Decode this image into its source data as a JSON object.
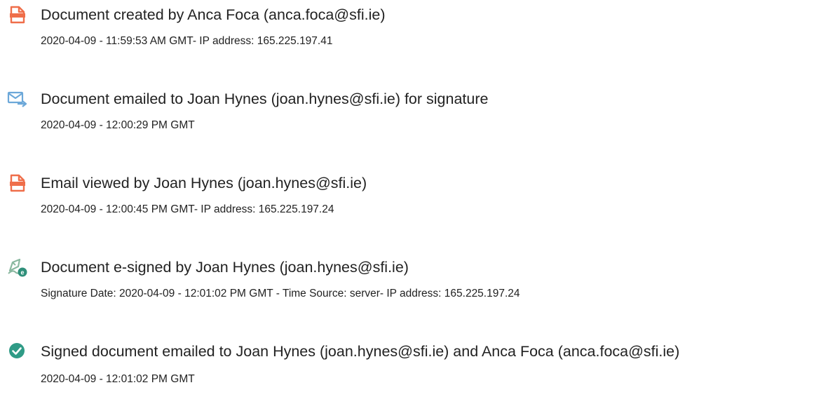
{
  "colors": {
    "document_icon": "#EF6E4A",
    "email_icon": "#6CA8D9",
    "esign_icon": "#8AB8A0",
    "esign_badge": "#2F8F7A",
    "check_icon": "#2F9B86",
    "text": "#222222"
  },
  "events": [
    {
      "icon": "document-icon",
      "title": "Document created by Anca Foca (anca.foca@sfi.ie)",
      "meta": "2020-04-09 - 11:59:53 AM GMT- IP address: 165.225.197.41"
    },
    {
      "icon": "email-send-icon",
      "title": "Document emailed to Joan Hynes (joan.hynes@sfi.ie) for signature",
      "meta": "2020-04-09 - 12:00:29 PM GMT"
    },
    {
      "icon": "document-icon",
      "title": "Email viewed by Joan Hynes (joan.hynes@sfi.ie)",
      "meta": "2020-04-09 - 12:00:45 PM GMT- IP address: 165.225.197.24"
    },
    {
      "icon": "esign-pen-icon",
      "title": "Document e-signed by Joan Hynes (joan.hynes@sfi.ie)",
      "meta": "Signature Date: 2020-04-09 - 12:01:02 PM GMT - Time Source: server- IP address: 165.225.197.24"
    },
    {
      "icon": "check-circle-icon",
      "title": "Signed document emailed to Joan Hynes (joan.hynes@sfi.ie) and Anca Foca (anca.foca@sfi.ie)",
      "meta": "2020-04-09 - 12:01:02 PM GMT"
    }
  ]
}
